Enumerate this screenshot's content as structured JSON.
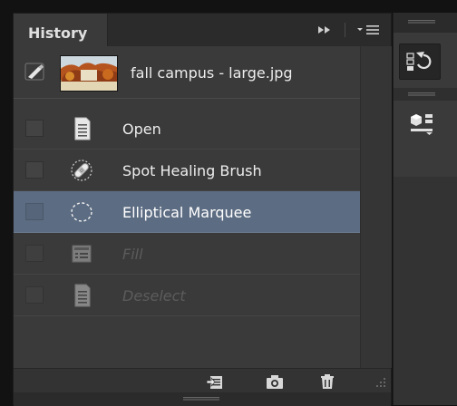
{
  "panel": {
    "tab_title": "History",
    "snapshot": {
      "label": "fall campus - large.jpg",
      "thumbnail_icon": "campus-photo-thumbnail"
    },
    "history_items": [
      {
        "label": "Open",
        "icon": "document-icon",
        "state": "normal"
      },
      {
        "label": "Spot Healing Brush",
        "icon": "bandage-icon",
        "state": "normal"
      },
      {
        "label": "Elliptical Marquee",
        "icon": "elliptical-marquee-icon",
        "state": "selected"
      },
      {
        "label": "Fill",
        "icon": "fill-icon",
        "state": "dimmed"
      },
      {
        "label": "Deselect",
        "icon": "document-icon",
        "state": "dimmed"
      }
    ],
    "bottom_actions": [
      "new-document-from-state-icon",
      "camera-icon",
      "trash-icon"
    ]
  },
  "colors": {
    "panel_bg": "#3a3a3a",
    "selected_row": "#5c6c82",
    "dim_text": "#5c5c5c"
  }
}
